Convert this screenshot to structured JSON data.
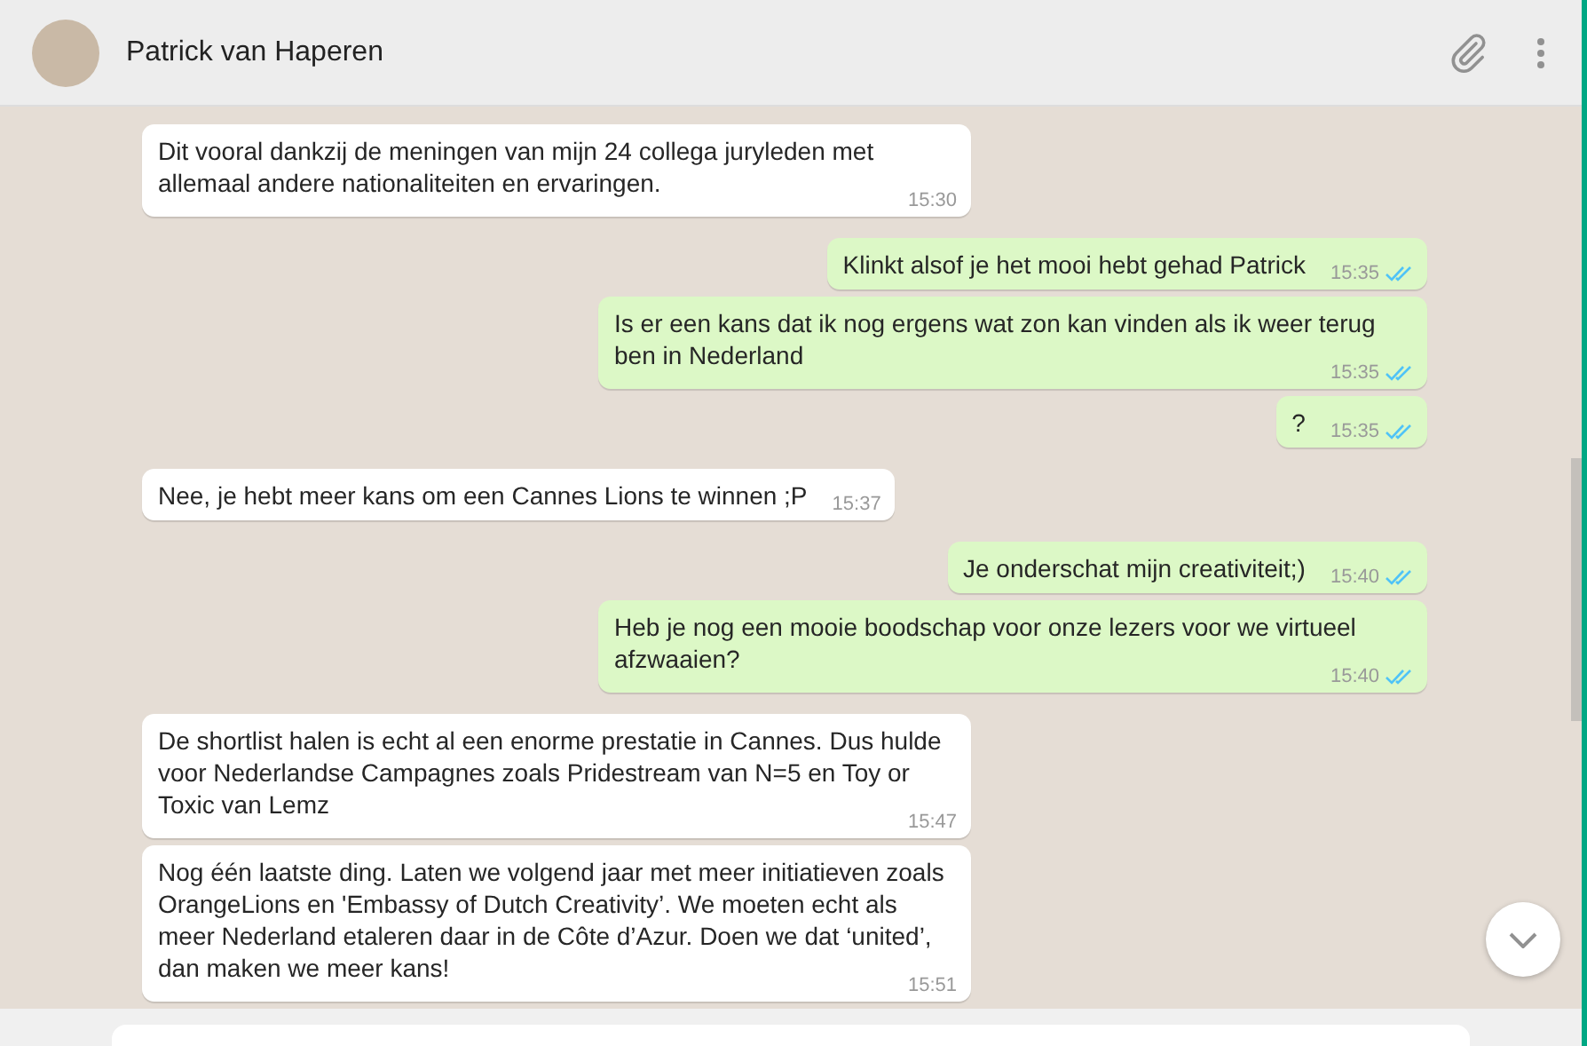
{
  "header": {
    "contact_name": "Patrick van Haperen"
  },
  "messages": [
    {
      "kind": "in",
      "text": "Dit vooral dankzij de meningen van mijn 24 collega juryleden met allemaal andere nationaliteiten en ervaringen.",
      "time": "15:30"
    },
    {
      "kind": "out",
      "text": "Klinkt alsof je het mooi hebt gehad Patrick",
      "time": "15:35",
      "read": true
    },
    {
      "kind": "out",
      "text": "Is er een kans dat ik nog ergens wat zon kan vinden als ik weer terug ben in Nederland",
      "time": "15:35",
      "read": true
    },
    {
      "kind": "out",
      "text": "?",
      "time": "15:35",
      "read": true
    },
    {
      "kind": "in",
      "text": "Nee, je hebt meer kans om een Cannes Lions te winnen ;P",
      "time": "15:37"
    },
    {
      "kind": "out",
      "text": "Je onderschat mijn creativiteit;)",
      "time": "15:40",
      "read": true
    },
    {
      "kind": "out",
      "text": "Heb je nog een mooie boodschap voor onze lezers voor we virtueel afzwaaien?",
      "time": "15:40",
      "read": true
    },
    {
      "kind": "in",
      "text": "De shortlist halen is echt al een enorme prestatie in Cannes. Dus hulde voor Nederlandse Campagnes zoals Pridestream van N=5 en Toy or Toxic van Lemz",
      "time": "15:47"
    },
    {
      "kind": "in",
      "text": "Nog één laatste ding. Laten we volgend jaar met meer initiatieven zoals OrangeLions en 'Embassy of Dutch Creativity’. We moeten echt als meer Nederland etaleren daar in de Côte d’Azur. Doen we dat ‘united’, dan maken we meer kans!",
      "time": "15:51"
    }
  ]
}
